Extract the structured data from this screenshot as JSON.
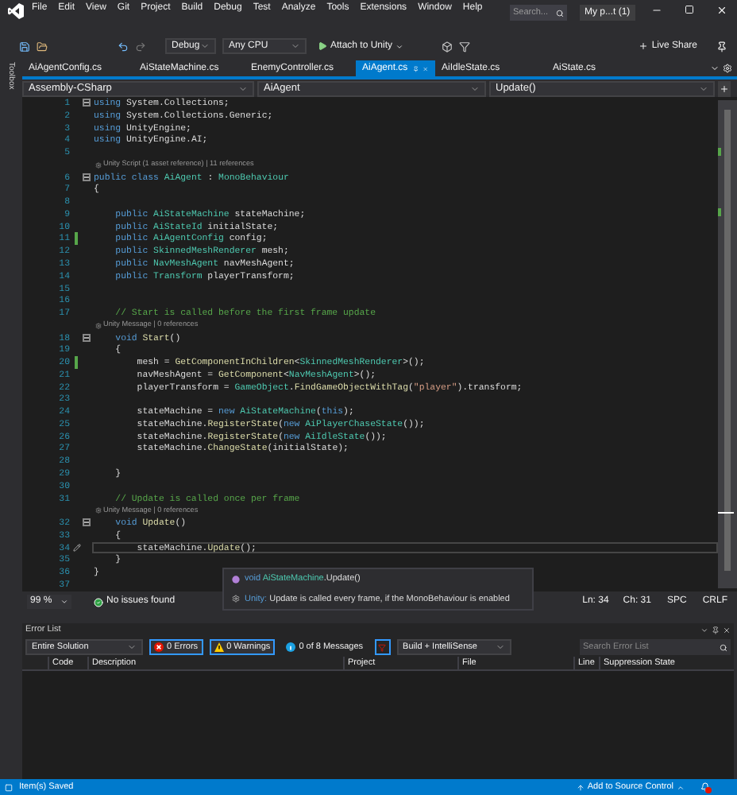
{
  "menu": [
    "File",
    "Edit",
    "View",
    "Git",
    "Project",
    "Build",
    "Debug",
    "Test",
    "Analyze",
    "Tools",
    "Extensions",
    "Window",
    "Help"
  ],
  "search": {
    "placeholder": "Search..."
  },
  "account": "My p...t (1)",
  "toolbar": {
    "configuration": "Debug",
    "platform": "Any CPU",
    "run": "Attach to Unity",
    "live_share": "Live Share"
  },
  "toolbox": "Toolbox",
  "tabs": [
    {
      "label": "AiAgentConfig.cs",
      "selected": false
    },
    {
      "label": "AiStateMachine.cs",
      "selected": false
    },
    {
      "label": "EnemyController.cs",
      "selected": false
    },
    {
      "label": "AiAgent.cs",
      "selected": true
    },
    {
      "label": "AiIdleState.cs",
      "selected": false
    },
    {
      "label": "AiState.cs",
      "selected": false
    }
  ],
  "nav_bar": [
    "Assembly-CSharp",
    "AiAgent",
    "Update()"
  ],
  "code_lines": [
    {
      "kind": "code",
      "number": "1",
      "changed": false,
      "fold": true,
      "current": false,
      "tokens": [
        {
          "kind": "keyword",
          "text": "using"
        },
        {
          "kind": "plain",
          "text": " System.Collections;"
        }
      ]
    },
    {
      "kind": "code",
      "number": "2",
      "changed": false,
      "fold": false,
      "current": false,
      "tokens": [
        {
          "kind": "keyword",
          "text": "using"
        },
        {
          "kind": "plain",
          "text": " System.Collections.Generic;"
        }
      ]
    },
    {
      "kind": "code",
      "number": "3",
      "changed": false,
      "fold": false,
      "current": false,
      "tokens": [
        {
          "kind": "keyword",
          "text": "using"
        },
        {
          "kind": "plain",
          "text": " UnityEngine;"
        }
      ]
    },
    {
      "kind": "code",
      "number": "4",
      "changed": false,
      "fold": false,
      "current": false,
      "tokens": [
        {
          "kind": "keyword",
          "text": "using"
        },
        {
          "kind": "plain",
          "text": " UnityEngine.AI;"
        }
      ]
    },
    {
      "kind": "code",
      "number": "5",
      "changed": false,
      "fold": false,
      "current": false
    },
    {
      "kind": "lens",
      "text": "Unity Script (1 asset reference) | 11 references"
    },
    {
      "kind": "code",
      "number": "6",
      "changed": false,
      "fold": true,
      "current": false,
      "tokens": [
        {
          "kind": "keyword",
          "text": "public class "
        },
        {
          "kind": "type",
          "text": "AiAgent"
        },
        {
          "kind": "plain",
          "text": " : "
        },
        {
          "kind": "type",
          "text": "MonoBehaviour"
        }
      ]
    },
    {
      "kind": "code",
      "number": "7",
      "changed": false,
      "fold": false,
      "current": false,
      "tokens": [
        {
          "kind": "plain",
          "text": "{"
        }
      ]
    },
    {
      "kind": "code",
      "number": "8",
      "changed": false,
      "fold": false,
      "current": false
    },
    {
      "kind": "code",
      "number": "9",
      "changed": false,
      "fold": false,
      "current": false,
      "tokens": [
        {
          "kind": "keyword",
          "text": "    public "
        },
        {
          "kind": "type",
          "text": "AiStateMachine"
        },
        {
          "kind": "plain",
          "text": " stateMachine;"
        }
      ]
    },
    {
      "kind": "code",
      "number": "10",
      "changed": false,
      "fold": false,
      "current": false,
      "tokens": [
        {
          "kind": "keyword",
          "text": "    public "
        },
        {
          "kind": "type",
          "text": "AiStateId"
        },
        {
          "kind": "plain",
          "text": " initialState;"
        }
      ]
    },
    {
      "kind": "code",
      "number": "11",
      "changed": true,
      "fold": false,
      "current": false,
      "tokens": [
        {
          "kind": "keyword",
          "text": "    public "
        },
        {
          "kind": "type",
          "text": "AiAgentConfig"
        },
        {
          "kind": "plain",
          "text": " config;"
        }
      ]
    },
    {
      "kind": "code",
      "number": "12",
      "changed": false,
      "fold": false,
      "current": false,
      "tokens": [
        {
          "kind": "keyword",
          "text": "    public "
        },
        {
          "kind": "type",
          "text": "SkinnedMeshRenderer"
        },
        {
          "kind": "plain",
          "text": " mesh;"
        }
      ]
    },
    {
      "kind": "code",
      "number": "13",
      "changed": false,
      "fold": false,
      "current": false,
      "tokens": [
        {
          "kind": "keyword",
          "text": "    public "
        },
        {
          "kind": "type",
          "text": "NavMeshAgent"
        },
        {
          "kind": "plain",
          "text": " navMeshAgent;"
        }
      ]
    },
    {
      "kind": "code",
      "number": "14",
      "changed": false,
      "fold": false,
      "current": false,
      "tokens": [
        {
          "kind": "keyword",
          "text": "    public "
        },
        {
          "kind": "type",
          "text": "Transform"
        },
        {
          "kind": "plain",
          "text": " playerTransform;"
        }
      ]
    },
    {
      "kind": "code",
      "number": "15",
      "changed": false,
      "fold": false,
      "current": false
    },
    {
      "kind": "code",
      "number": "16",
      "changed": false,
      "fold": false,
      "current": false
    },
    {
      "kind": "code",
      "number": "17",
      "changed": false,
      "fold": false,
      "current": false,
      "tokens": [
        {
          "kind": "comment",
          "text": "    // Start is called before the first frame update"
        }
      ]
    },
    {
      "kind": "lens",
      "text": "Unity Message | 0 references"
    },
    {
      "kind": "code",
      "number": "18",
      "changed": false,
      "fold": true,
      "current": false,
      "tokens": [
        {
          "kind": "keyword",
          "text": "    void "
        },
        {
          "kind": "method",
          "text": "Start"
        },
        {
          "kind": "plain",
          "text": "()"
        }
      ]
    },
    {
      "kind": "code",
      "number": "19",
      "changed": false,
      "fold": false,
      "current": false,
      "tokens": [
        {
          "kind": "plain",
          "text": "    {"
        }
      ]
    },
    {
      "kind": "code",
      "number": "20",
      "changed": true,
      "fold": false,
      "current": false,
      "tokens": [
        {
          "kind": "plain",
          "text": "        mesh = "
        },
        {
          "kind": "method",
          "text": "GetComponentInChildren"
        },
        {
          "kind": "plain",
          "text": "<"
        },
        {
          "kind": "type",
          "text": "SkinnedMeshRenderer"
        },
        {
          "kind": "plain",
          "text": ">();"
        }
      ]
    },
    {
      "kind": "code",
      "number": "21",
      "changed": false,
      "fold": false,
      "current": false,
      "tokens": [
        {
          "kind": "plain",
          "text": "        navMeshAgent = "
        },
        {
          "kind": "method",
          "text": "GetComponent"
        },
        {
          "kind": "plain",
          "text": "<"
        },
        {
          "kind": "type",
          "text": "NavMeshAgent"
        },
        {
          "kind": "plain",
          "text": ">();"
        }
      ]
    },
    {
      "kind": "code",
      "number": "22",
      "changed": false,
      "fold": false,
      "current": false,
      "tokens": [
        {
          "kind": "plain",
          "text": "        playerTransform = "
        },
        {
          "kind": "type",
          "text": "GameObject"
        },
        {
          "kind": "plain",
          "text": "."
        },
        {
          "kind": "method",
          "text": "FindGameObjectWithTag"
        },
        {
          "kind": "plain",
          "text": "("
        },
        {
          "kind": "string",
          "text": "\"player\""
        },
        {
          "kind": "plain",
          "text": ").transform;"
        }
      ]
    },
    {
      "kind": "code",
      "number": "23",
      "changed": false,
      "fold": false,
      "current": false
    },
    {
      "kind": "code",
      "number": "24",
      "changed": false,
      "fold": false,
      "current": false,
      "tokens": [
        {
          "kind": "plain",
          "text": "        stateMachine = "
        },
        {
          "kind": "keyword",
          "text": "new "
        },
        {
          "kind": "type",
          "text": "AiStateMachine"
        },
        {
          "kind": "plain",
          "text": "("
        },
        {
          "kind": "keyword",
          "text": "this"
        },
        {
          "kind": "plain",
          "text": ");"
        }
      ]
    },
    {
      "kind": "code",
      "number": "25",
      "changed": false,
      "fold": false,
      "current": false,
      "tokens": [
        {
          "kind": "plain",
          "text": "        stateMachine."
        },
        {
          "kind": "method",
          "text": "RegisterState"
        },
        {
          "kind": "plain",
          "text": "("
        },
        {
          "kind": "keyword",
          "text": "new "
        },
        {
          "kind": "type",
          "text": "AiPlayerChaseState"
        },
        {
          "kind": "plain",
          "text": "());"
        }
      ]
    },
    {
      "kind": "code",
      "number": "26",
      "changed": false,
      "fold": false,
      "current": false,
      "tokens": [
        {
          "kind": "plain",
          "text": "        stateMachine."
        },
        {
          "kind": "method",
          "text": "RegisterState"
        },
        {
          "kind": "plain",
          "text": "("
        },
        {
          "kind": "keyword",
          "text": "new "
        },
        {
          "kind": "type",
          "text": "AiIdleState"
        },
        {
          "kind": "plain",
          "text": "());"
        }
      ]
    },
    {
      "kind": "code",
      "number": "27",
      "changed": false,
      "fold": false,
      "current": false,
      "tokens": [
        {
          "kind": "plain",
          "text": "        stateMachine."
        },
        {
          "kind": "method",
          "text": "ChangeState"
        },
        {
          "kind": "plain",
          "text": "(initialState);"
        }
      ]
    },
    {
      "kind": "code",
      "number": "28",
      "changed": false,
      "fold": false,
      "current": false
    },
    {
      "kind": "code",
      "number": "29",
      "changed": false,
      "fold": false,
      "current": false,
      "tokens": [
        {
          "kind": "plain",
          "text": "    }"
        }
      ]
    },
    {
      "kind": "code",
      "number": "30",
      "changed": false,
      "fold": false,
      "current": false
    },
    {
      "kind": "code",
      "number": "31",
      "changed": false,
      "fold": false,
      "current": false,
      "tokens": [
        {
          "kind": "comment",
          "text": "    // Update is called once per frame"
        }
      ]
    },
    {
      "kind": "lens",
      "text": "Unity Message | 0 references"
    },
    {
      "kind": "code",
      "number": "32",
      "changed": false,
      "fold": true,
      "current": false,
      "tokens": [
        {
          "kind": "keyword",
          "text": "    void "
        },
        {
          "kind": "method",
          "text": "Update"
        },
        {
          "kind": "plain",
          "text": "()"
        }
      ]
    },
    {
      "kind": "code",
      "number": "33",
      "changed": false,
      "fold": false,
      "current": false,
      "tokens": [
        {
          "kind": "plain",
          "text": "    {"
        }
      ]
    },
    {
      "kind": "code",
      "number": "34",
      "changed": false,
      "fold": false,
      "current": true,
      "tokens": [
        {
          "kind": "plain",
          "text": "        stateMachine."
        },
        {
          "kind": "method",
          "text": "Update"
        },
        {
          "kind": "plain",
          "text": "();"
        }
      ]
    },
    {
      "kind": "code",
      "number": "35",
      "changed": false,
      "fold": false,
      "current": false,
      "tokens": [
        {
          "kind": "plain",
          "text": "    }"
        }
      ]
    },
    {
      "kind": "code",
      "number": "36",
      "changed": false,
      "fold": false,
      "current": false,
      "tokens": [
        {
          "kind": "plain",
          "text": "}"
        }
      ]
    },
    {
      "kind": "code",
      "number": "37",
      "changed": false,
      "fold": false,
      "current": false
    }
  ],
  "tooltip": {
    "signature": [
      {
        "kind": "keyword",
        "text": "void "
      },
      {
        "kind": "type",
        "text": "AiStateMachine"
      },
      {
        "kind": "plain",
        "text": ".Update()"
      }
    ],
    "source": "Unity:",
    "description": "Update is called every frame, if the MonoBehaviour is enabled"
  },
  "editor_status": {
    "zoom": "99 %",
    "issues": "No issues found",
    "line": "Ln: 34",
    "column": "Ch: 31",
    "indent": "SPC",
    "line_endings": "CRLF"
  },
  "error_list": {
    "title": "Error List",
    "scope": "Entire Solution",
    "filters": [
      {
        "kind": "error",
        "label": "0 Errors",
        "selected": true
      },
      {
        "kind": "warning",
        "label": "0 Warnings",
        "selected": true
      },
      {
        "kind": "message",
        "label": "0 of 8 Messages",
        "selected": false
      }
    ],
    "build_filter_selected": true,
    "source": "Build + IntelliSense",
    "search": {
      "placeholder": "Search Error List"
    },
    "columns": [
      "Code",
      "Description",
      "Project",
      "File",
      "Line",
      "Suppression State"
    ]
  },
  "status_bar": {
    "message": "Item(s) Saved",
    "source_control": "Add to Source Control"
  }
}
